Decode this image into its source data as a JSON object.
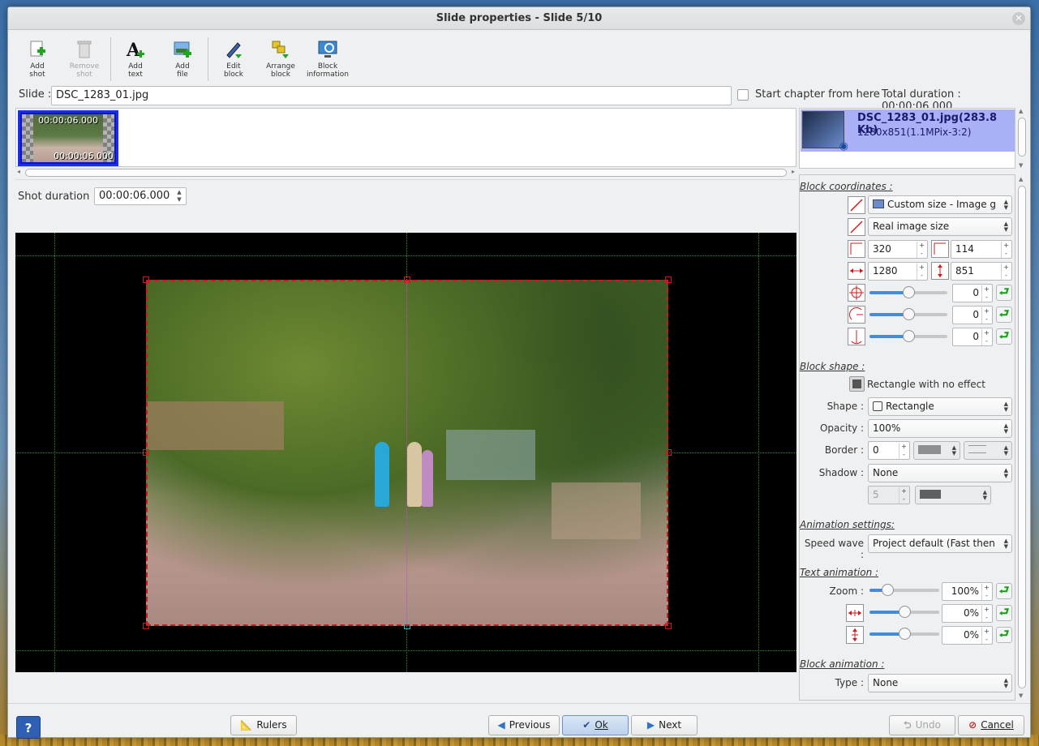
{
  "window": {
    "title": "Slide properties - Slide 5/10"
  },
  "toolbar": {
    "add_shot": "Add\nshot",
    "remove_shot": "Remove\nshot",
    "add_text": "Add\ntext",
    "add_file": "Add\nfile",
    "edit_block": "Edit\nblock",
    "arrange_block": "Arrange\nblock",
    "block_information": "Block\ninformation"
  },
  "slide": {
    "label": "Slide :",
    "name": "DSC_1283_01.jpg",
    "chapter_label": "Start chapter from here",
    "chapter_checked": false,
    "total_duration": "Total duration : 00:00:06.000"
  },
  "timeline": {
    "shot_time_top": "00:00:06.000",
    "shot_time_bottom": "00:00:06.000"
  },
  "shot": {
    "label": "Shot duration :",
    "value": "00:00:06.000"
  },
  "block_list": {
    "name": "DSC_1283_01.jpg(283.8 Kb)",
    "info": "1280x851(1.1MPix-3:2)"
  },
  "block_coordinates": {
    "title": "Block coordinates :",
    "size_mode": "Custom size - Image g",
    "image_size": "Real image size",
    "x": "320",
    "y": "114",
    "width": "1280",
    "height": "851",
    "rotation_z": "0",
    "rotation_x": "0",
    "rotation_y": "0",
    "slider_z": 0.5,
    "slider_x": 0.5,
    "slider_y": 0.5
  },
  "block_shape": {
    "title": "Block shape :",
    "preset": "Rectangle with no effect",
    "shape_label": "Shape :",
    "shape": "Rectangle",
    "opacity_label": "Opacity :",
    "opacity": "100%",
    "border_label": "Border :",
    "border": "0",
    "shadow_label": "Shadow :",
    "shadow": "None",
    "shadow_size": "5"
  },
  "animation_settings": {
    "title": "Animation settings:",
    "speed_label": "Speed wave :",
    "speed": "Project default (Fast then"
  },
  "text_animation": {
    "title": "Text animation :",
    "zoom_label": "Zoom :",
    "zoom": "100%",
    "h": "0%",
    "v": "0%",
    "slider_zoom": 0.25,
    "slider_h": 0.5,
    "slider_v": 0.5
  },
  "block_animation": {
    "title": "Block animation :",
    "type_label": "Type :",
    "type": "None"
  },
  "buttons": {
    "help": "?",
    "rulers": "Rulers",
    "previous": "Previous",
    "ok": "Ok",
    "next": "Next",
    "undo": "Undo",
    "cancel": "Cancel"
  },
  "colors": {
    "accent": "#1a2cf0",
    "selection": "#d0191b",
    "selected_item": "#aab0f5",
    "reset_arrow": "#18a018"
  }
}
